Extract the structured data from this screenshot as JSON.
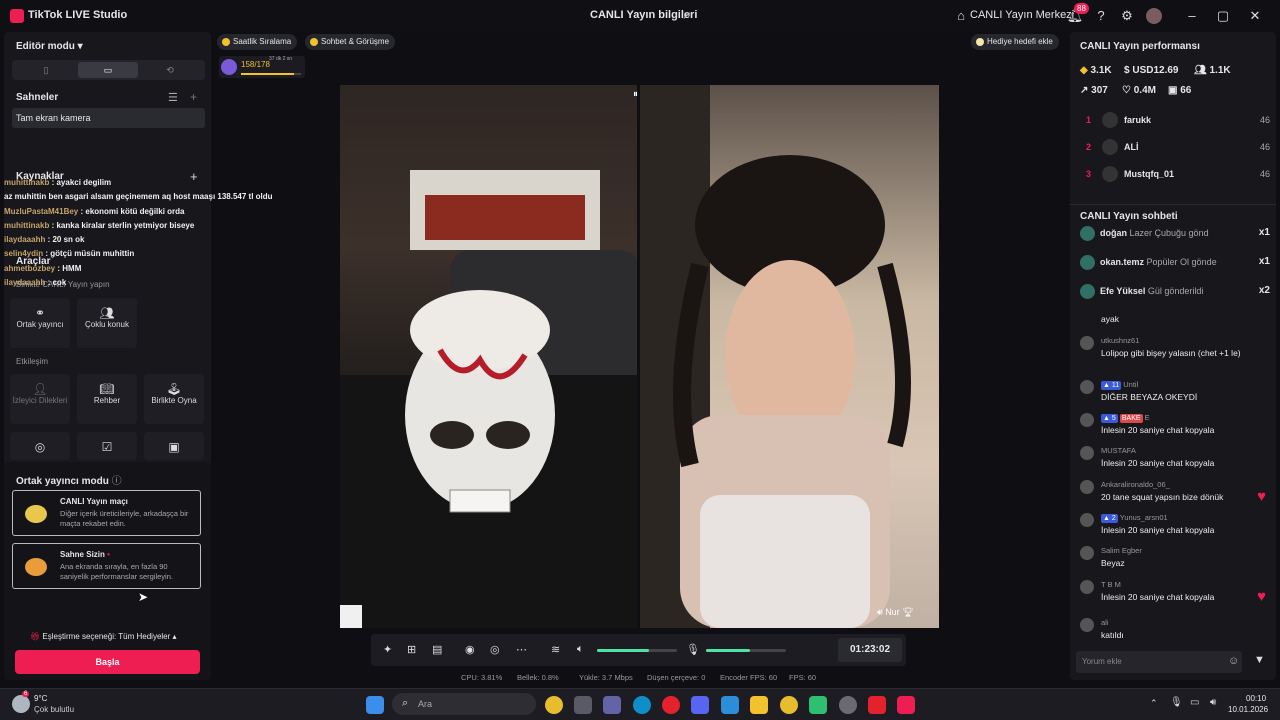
{
  "titlebar": {
    "app": "TikTok LIVE Studio",
    "center": "CANLI Yayın bilgileri",
    "center_icon": "share-icon",
    "live_center": "CANLI Yayın Merkezi",
    "notif_count": "88"
  },
  "left": {
    "editor_mode": "Editör modu",
    "scenes": "Sahneler",
    "scene_item": "Tam ekran kamera",
    "sources": "Kaynaklar",
    "tools": "Araçlar",
    "collab_label": "Birlikte CANLI Yayın yapın",
    "tool_cohost": "Ortak yayıncı",
    "tool_multiguest": "Çoklu konuk",
    "interaction": "Etkileşim",
    "tool_viewer_wishes": "İzleyici Dilekleri",
    "tool_guide": "Rehber",
    "tool_play_together": "Birlikte Oyna",
    "cohost_mode": "Ortak yayıncı modu",
    "card1_title": "CANLI Yayın maçı",
    "card1_desc": "Diğer içerik üreticileriyle, arkadaşça bir maçta rekabet edin.",
    "card2_title": "Sahne Sizin",
    "card2_desc": "Ana ekranda sırayla, en fazla 90 saniyelik performanslar sergileyin.",
    "match_option": "Eşleştirme seçeneği: Tüm Hediyeler",
    "start": "Başla"
  },
  "chat_overlay": [
    {
      "user": "muhittinakb",
      "msg": ": ayakci degilim"
    },
    {
      "user": "",
      "msg": "az muhittin ben asgari alsam geçinemem aq host maaşı 138.547 tl oldu"
    },
    {
      "user": "MuzluPastaM41Bey",
      "msg": ": ekonomi kötü değilki orda"
    },
    {
      "user": "muhittinakb",
      "msg": ": kanka kiralar sterlin yetmiyor biseye"
    },
    {
      "user": "ilaydaaahh",
      "msg": ": 20 sn ok"
    },
    {
      "user": "",
      "msg": ""
    },
    {
      "user": "selin4ydin",
      "msg": ": götçü müsün muhittin"
    },
    {
      "user": "ahmetbozbey",
      "msg": ": HMM"
    },
    {
      "user": "ilaydaaahh",
      "msg": ": cok"
    }
  ],
  "center": {
    "pill1": "Saatlik Sıralama",
    "pill2": "Sohbet & Görüşme",
    "gift_goal": "Hediye hedefi ekle",
    "progress_label": "158/178",
    "progress_value": 0.89,
    "progress_time": "37 dk 2 sn",
    "guest_name": "Nur",
    "timer": "01:23:02",
    "speaker_level": 0.65,
    "mic_level": 0.55,
    "stats": [
      "CPU: 3.81%",
      "Bellek: 0.8%",
      "Yükle: 3.7 Mbps",
      "Düşen çerçeve: 0",
      "Encoder FPS: 60",
      "FPS: 60"
    ]
  },
  "right": {
    "perf_title": "CANLI Yayın performansı",
    "stat_diamonds": "3.1K",
    "stat_usd": "USD12.69",
    "stat_viewers": "1.1K",
    "stat_share": "307",
    "stat_likes": "0.4M",
    "stat_gifters": "66",
    "ranking": [
      {
        "rank": "1",
        "name": "farukk",
        "score": "46"
      },
      {
        "rank": "2",
        "name": "ALİ",
        "score": "46"
      },
      {
        "rank": "3",
        "name": "Mustqfq_01",
        "score": "46"
      }
    ],
    "chat_title": "CANLI Yayın sohbeti",
    "gifts": [
      {
        "name": "doğan",
        "gift": "Lazer Çubuğu gönd",
        "count": "x1"
      },
      {
        "name": "okan.temz",
        "gift": "Popüler Ol gönde",
        "count": "x1"
      },
      {
        "name": "Efe Yüksel",
        "gift": "Gül gönderildi",
        "count": "x2"
      }
    ],
    "messages": [
      {
        "user": "",
        "text": "ayak",
        "level": ""
      },
      {
        "user": "utkushnz61",
        "text": "Lolipop gibi bişey yalasın (chet +1 le)",
        "level": ""
      },
      {
        "user": "Until",
        "text": "DİĞER BEYAZA OKEYDİ",
        "level": "11"
      },
      {
        "user": "E",
        "text": "İnlesin 20 saniye chat kopyala",
        "level": "5"
      },
      {
        "user": "MUSTAFA",
        "text": "İnlesin 20 saniye chat kopyala",
        "level": ""
      },
      {
        "user": "Ankaralironaldo_06_",
        "text": "20 tane squat yapsın bize dönük",
        "level": ""
      },
      {
        "user": "Yunus_arsn01",
        "text": "İnlesin 20 saniye chat kopyala",
        "level": "2"
      },
      {
        "user": "Salim Egber",
        "text": "Beyaz",
        "level": ""
      },
      {
        "user": "T B M",
        "text": "İnlesin 20 saniye chat kopyala",
        "level": ""
      },
      {
        "user": "ali",
        "text": "katıldı",
        "level": ""
      }
    ],
    "badge_bake": "BAKE",
    "comment_placeholder": "Yorum ekle"
  },
  "taskbar": {
    "temp": "9°C",
    "weather": "Çok bulutlu",
    "weather_badge": "6",
    "search": "Ara",
    "time": "00:10",
    "date": "10.01.2026"
  },
  "colors": {
    "accent": "#ee1d52",
    "level": "#3a5ad9",
    "meter": "#4be3a8"
  }
}
